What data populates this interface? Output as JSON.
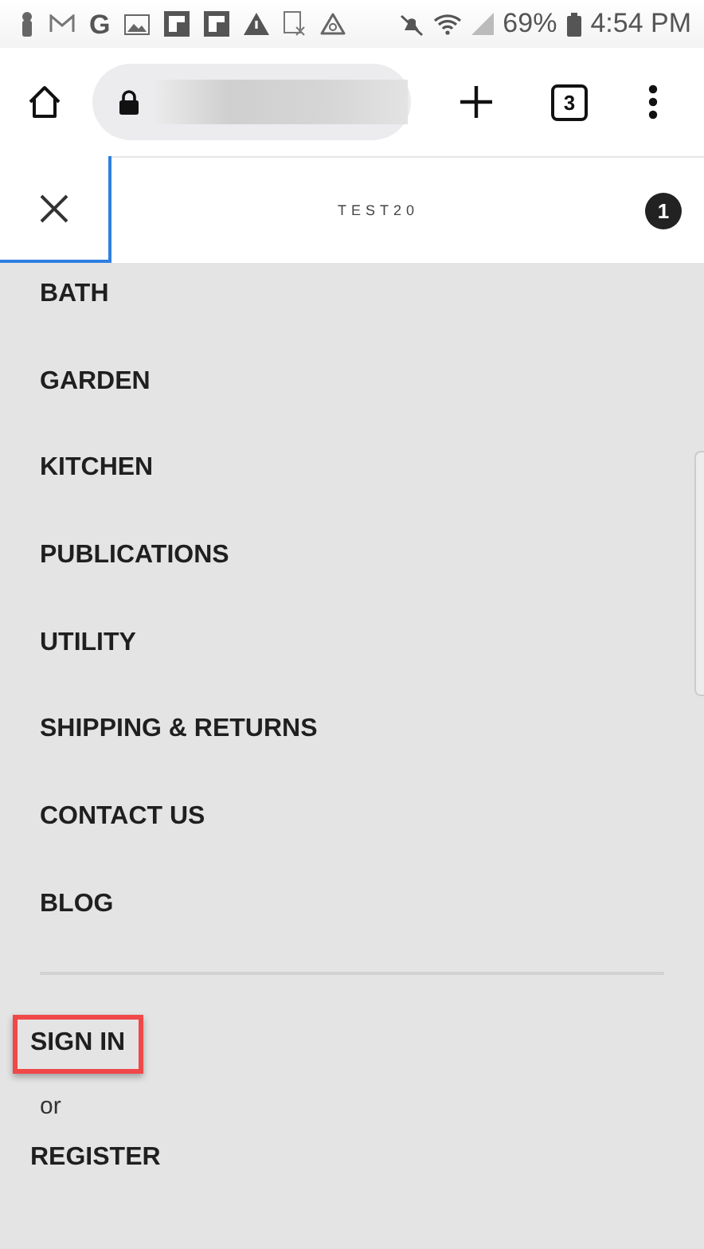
{
  "status_bar": {
    "g_icon": "G",
    "battery": "69%",
    "time": "4:54 PM"
  },
  "browser": {
    "tab_count": "3"
  },
  "header": {
    "title": "TEST20",
    "cart_count": "1"
  },
  "menu": {
    "items": [
      {
        "label": "BATH"
      },
      {
        "label": "GARDEN"
      },
      {
        "label": "KITCHEN"
      },
      {
        "label": "PUBLICATIONS"
      },
      {
        "label": "UTILITY"
      },
      {
        "label": "SHIPPING & RETURNS"
      },
      {
        "label": "CONTACT US"
      },
      {
        "label": "BLOG"
      }
    ]
  },
  "account": {
    "sign_in": {
      "label": "SIGN IN",
      "highlighted": true
    },
    "or": "or",
    "register": {
      "label": "REGISTER",
      "highlighted": false
    }
  }
}
